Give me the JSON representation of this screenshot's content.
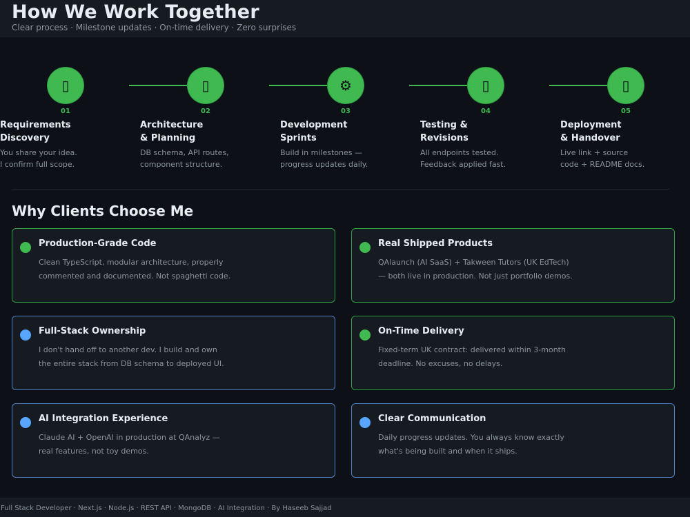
{
  "header": {
    "title": "How We Work Together",
    "subtitle": "Clear process · Milestone updates · On-time delivery · Zero surprises"
  },
  "steps": [
    {
      "icon": "clipboard-icon",
      "glyph": "▯",
      "number": "01",
      "title_line1": "Requirements",
      "title_line2": "Discovery",
      "desc_line1": "You share your idea.",
      "desc_line2": "I confirm full scope."
    },
    {
      "icon": "blueprint-icon",
      "glyph": "▯",
      "number": "02",
      "title_line1": "Architecture",
      "title_line2": "& Planning",
      "desc_line1": "DB schema, API routes,",
      "desc_line2": "component structure."
    },
    {
      "icon": "gear-icon",
      "glyph": "⚙",
      "number": "03",
      "title_line1": "Development",
      "title_line2": "Sprints",
      "desc_line1": "Build in milestones —",
      "desc_line2": "progress updates daily."
    },
    {
      "icon": "test-icon",
      "glyph": "▯",
      "number": "04",
      "title_line1": "Testing &",
      "title_line2": "Revisions",
      "desc_line1": "All endpoints tested.",
      "desc_line2": "Feedback applied fast."
    },
    {
      "icon": "rocket-icon",
      "glyph": "▯",
      "number": "05",
      "title_line1": "Deployment",
      "title_line2": "& Handover",
      "desc_line1": "Live link + source",
      "desc_line2": "code + README docs."
    }
  ],
  "why": {
    "title": "Why Clients Choose Me",
    "cards": [
      {
        "title": "Production-Grade Code",
        "desc_line1": "Clean TypeScript, modular architecture, properly",
        "desc_line2": "commented and documented. Not spaghetti code.",
        "accent": "#3fb950"
      },
      {
        "title": "Real Shipped Products",
        "desc_line1": "QAlaunch (AI SaaS) + Takween Tutors (UK EdTech)",
        "desc_line2": "— both live in production. Not just portfolio demos.",
        "accent": "#3fb950"
      },
      {
        "title": "Full-Stack Ownership",
        "desc_line1": "I don't hand off to another dev. I build and own",
        "desc_line2": "the entire stack from DB schema to deployed UI.",
        "accent": "#58a6ff"
      },
      {
        "title": "On-Time Delivery",
        "desc_line1": "Fixed-term UK contract: delivered within 3-month",
        "desc_line2": "deadline. No excuses, no delays.",
        "accent": "#3fb950"
      },
      {
        "title": "AI Integration Experience",
        "desc_line1": "Claude AI + OpenAI in production at QAnalyz —",
        "desc_line2": "real features, not toy demos.",
        "accent": "#58a6ff"
      },
      {
        "title": "Clear Communication",
        "desc_line1": "Daily progress updates. You always know exactly",
        "desc_line2": "what's being built and when it ships.",
        "accent": "#58a6ff"
      }
    ]
  },
  "footer": {
    "text": "Full Stack Developer  ·  Next.js · Node.js · REST API · MongoDB · AI Integration  ·  By Haseeb Sajjad"
  },
  "colors": {
    "background": "#0d1117",
    "accent_green": "#3fb950",
    "accent_blue": "#58a6ff"
  }
}
